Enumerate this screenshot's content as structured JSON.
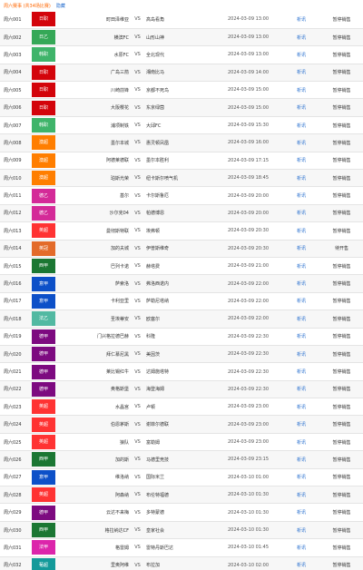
{
  "header": {
    "title": "周六赛事 (共34场比赛)",
    "link": "隐藏"
  },
  "vs_label": "VS",
  "matches": [
    {
      "no": "周六001",
      "league": "日职",
      "league_color": "#d3040b",
      "home": "町田泽维亚",
      "away": "高岛看角",
      "time": "2024-03-09 13:00",
      "analysis": "析讯",
      "status": "暂停销售"
    },
    {
      "no": "周六002",
      "league": "日乙",
      "league_color": "#35a857",
      "home": "横滨FC",
      "away": "山形山神",
      "time": "2024-03-09 13:00",
      "analysis": "析讯",
      "status": "暂停销售"
    },
    {
      "no": "周六003",
      "league": "韩职",
      "league_color": "#3fb46a",
      "home": "水原FC",
      "away": "全北现代",
      "time": "2024-03-09 13:00",
      "analysis": "析讯",
      "status": "暂停销售"
    },
    {
      "no": "周六004",
      "league": "日职",
      "league_color": "#d3040b",
      "home": "广岛三箭",
      "away": "湘南比马",
      "time": "2024-03-09 14:00",
      "analysis": "析讯",
      "status": "暂停销售"
    },
    {
      "no": "周六005",
      "league": "日职",
      "league_color": "#d3040b",
      "home": "川崎前锋",
      "away": "京都不死鸟",
      "time": "2024-03-09 15:00",
      "analysis": "析讯",
      "status": "暂停销售"
    },
    {
      "no": "周六006",
      "league": "日职",
      "league_color": "#d3040b",
      "home": "大阪樱花",
      "away": "东京绿茵",
      "time": "2024-03-09 15:00",
      "analysis": "析讯",
      "status": "暂停销售"
    },
    {
      "no": "周六007",
      "league": "韩职",
      "league_color": "#3fb46a",
      "home": "浦项制铁",
      "away": "大邱FC",
      "time": "2024-03-09 15:30",
      "analysis": "析讯",
      "status": "暂停销售"
    },
    {
      "no": "周六008",
      "league": "澳超",
      "league_color": "#ff7e00",
      "home": "墨尔本城",
      "away": "惠灵顿凤凰",
      "time": "2024-03-09 16:00",
      "analysis": "析讯",
      "status": "暂停销售"
    },
    {
      "no": "周六009",
      "league": "澳超",
      "league_color": "#ff7e00",
      "home": "阿德莱德联",
      "away": "墨尔本胜利",
      "time": "2024-03-09 17:15",
      "analysis": "析讯",
      "status": "暂停销售"
    },
    {
      "no": "周六010",
      "league": "澳超",
      "league_color": "#ff7e00",
      "home": "珀斯光荣",
      "away": "纽卡斯尔喷气机",
      "time": "2024-03-09 18:45",
      "analysis": "析讯",
      "status": "暂停销售"
    },
    {
      "no": "周六011",
      "league": "德乙",
      "league_color": "#d42a98",
      "home": "基尔",
      "away": "卡尔斯鲁厄",
      "time": "2024-03-09 20:00",
      "analysis": "析讯",
      "status": "暂停销售"
    },
    {
      "no": "周六012",
      "league": "德乙",
      "league_color": "#d42a98",
      "home": "沙尔克04",
      "away": "帕德博恩",
      "time": "2024-03-09 20:00",
      "analysis": "析讯",
      "status": "暂停销售"
    },
    {
      "no": "周六013",
      "league": "英超",
      "league_color": "#ff3333",
      "home": "曼彻斯特联",
      "away": "埃弗顿",
      "time": "2024-03-09 20:30",
      "analysis": "析讯",
      "status": "暂停销售"
    },
    {
      "no": "周六014",
      "league": "英冠",
      "league_color": "#e36b2a",
      "home": "加的夫城",
      "away": "伊普斯维奇",
      "time": "2024-03-09 20:30",
      "analysis": "析讯",
      "status": "待开售"
    },
    {
      "no": "周六015",
      "league": "西甲",
      "league_color": "#1b7733",
      "home": "巴列卡诺",
      "away": "赫塔费",
      "time": "2024-03-09 21:00",
      "analysis": "析讯",
      "status": "暂停销售"
    },
    {
      "no": "周六016",
      "league": "意甲",
      "league_color": "#0d50c8",
      "home": "萨索洛",
      "away": "弗洛西诺内",
      "time": "2024-03-09 22:00",
      "analysis": "析讯",
      "status": "暂停销售"
    },
    {
      "no": "周六017",
      "league": "意甲",
      "league_color": "#0d50c8",
      "home": "卡利亚里",
      "away": "萨勒尼塔纳",
      "time": "2024-03-09 22:00",
      "analysis": "析讯",
      "status": "暂停销售"
    },
    {
      "no": "周六018",
      "league": "法乙",
      "league_color": "#52b9a2",
      "home": "圣埃蒂安",
      "away": "欧塞尔",
      "time": "2024-03-09 22:00",
      "analysis": "析讯",
      "status": "暂停销售"
    },
    {
      "no": "周六019",
      "league": "德甲",
      "league_color": "#7d0a80",
      "home": "门兴格拉德巴赫",
      "away": "科隆",
      "time": "2024-03-09 22:30",
      "analysis": "析讯",
      "status": "暂停销售"
    },
    {
      "no": "周六020",
      "league": "德甲",
      "league_color": "#7d0a80",
      "home": "拜仁慕尼黑",
      "away": "美因茨",
      "time": "2024-03-09 22:30",
      "analysis": "析讯",
      "status": "暂停销售"
    },
    {
      "no": "周六021",
      "league": "德甲",
      "league_color": "#7d0a80",
      "home": "莱比锡红牛",
      "away": "达姆施塔特",
      "time": "2024-03-09 22:30",
      "analysis": "析讯",
      "status": "暂停销售"
    },
    {
      "no": "周六022",
      "league": "德甲",
      "league_color": "#7d0a80",
      "home": "奥格斯堡",
      "away": "海登海姆",
      "time": "2024-03-09 22:30",
      "analysis": "析讯",
      "status": "暂停销售"
    },
    {
      "no": "周六023",
      "league": "英超",
      "league_color": "#ff3333",
      "home": "水晶宫",
      "away": "卢顿",
      "time": "2024-03-09 23:00",
      "analysis": "析讯",
      "status": "暂停销售"
    },
    {
      "no": "周六024",
      "league": "英超",
      "league_color": "#ff3333",
      "home": "伯恩茅斯",
      "away": "谢菲尔德联",
      "time": "2024-03-09 23:00",
      "analysis": "析讯",
      "status": "暂停销售"
    },
    {
      "no": "周六025",
      "league": "英超",
      "league_color": "#ff3333",
      "home": "狼队",
      "away": "富勒姆",
      "time": "2024-03-09 23:00",
      "analysis": "析讯",
      "status": "暂停销售"
    },
    {
      "no": "周六026",
      "league": "西甲",
      "league_color": "#1b7733",
      "home": "加的斯",
      "away": "马德里竞技",
      "time": "2024-03-09 23:15",
      "analysis": "析讯",
      "status": "暂停销售"
    },
    {
      "no": "周六027",
      "league": "意甲",
      "league_color": "#0d50c8",
      "home": "维洛纳",
      "away": "国际米兰",
      "time": "2024-03-10 01:00",
      "analysis": "析讯",
      "status": "暂停销售"
    },
    {
      "no": "周六028",
      "league": "英超",
      "league_color": "#ff3333",
      "home": "阿森纳",
      "away": "布伦特福德",
      "time": "2024-03-10 01:30",
      "analysis": "析讯",
      "status": "暂停销售"
    },
    {
      "no": "周六029",
      "league": "德甲",
      "league_color": "#7d0a80",
      "home": "云达不来梅",
      "away": "多特蒙德",
      "time": "2024-03-10 01:30",
      "analysis": "析讯",
      "status": "暂停销售"
    },
    {
      "no": "周六030",
      "league": "西甲",
      "league_color": "#1b7733",
      "home": "格拉纳达CF",
      "away": "皇家社会",
      "time": "2024-03-10 01:30",
      "analysis": "析讯",
      "status": "暂停销售"
    },
    {
      "no": "周六031",
      "league": "法甲",
      "league_color": "#dc25ab",
      "home": "格雷姆",
      "away": "雷特丹斯巴达",
      "time": "2024-03-10 01:45",
      "analysis": "析讯",
      "status": "暂停销售"
    },
    {
      "no": "周六032",
      "league": "葡超",
      "league_color": "#139a9a",
      "home": "里奥阿维",
      "away": "布拉加",
      "time": "2024-03-10 02:00",
      "analysis": "析讯",
      "status": "暂停销售"
    },
    {
      "no": "周六033",
      "league": "英冠",
      "league_color": "#e36b2a",
      "home": "伯明翰",
      "away": "普利茅斯",
      "time": "2024-03-10 03:00",
      "analysis": "析讯",
      "status": "待开售"
    }
  ]
}
